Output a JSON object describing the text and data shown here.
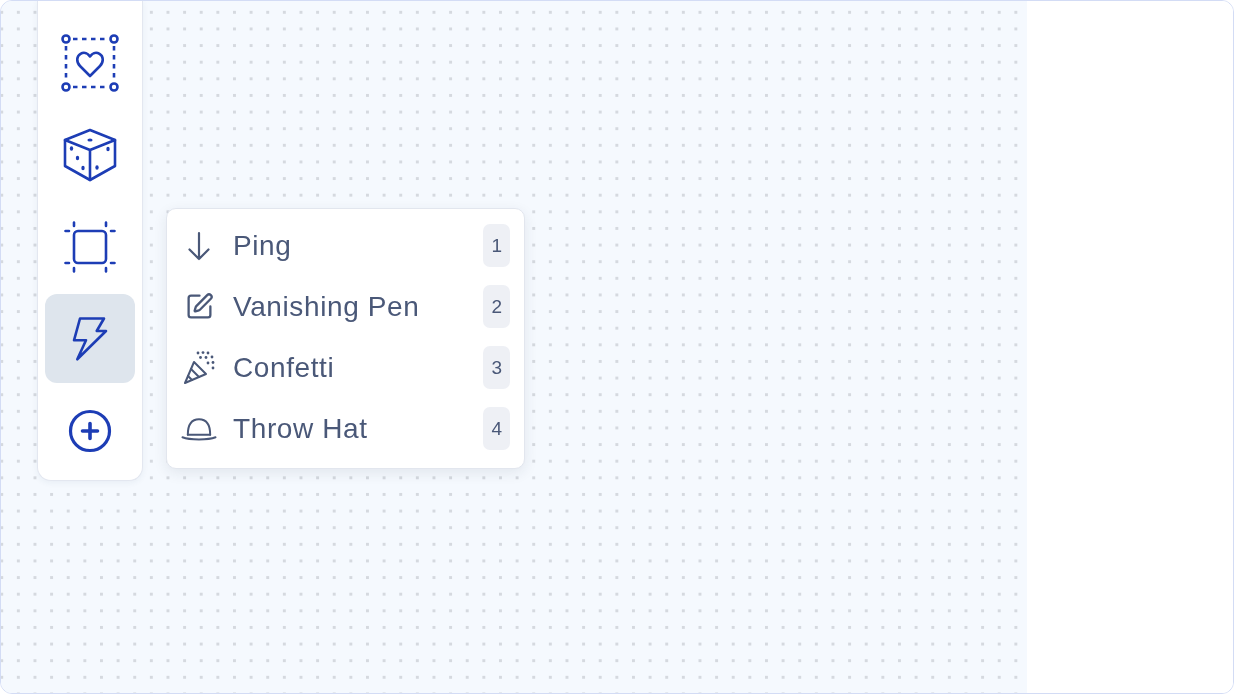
{
  "toolbar": {
    "tools": [
      {
        "selected": false
      },
      {
        "selected": false
      },
      {
        "selected": false
      },
      {
        "selected": true
      },
      {
        "selected": false
      }
    ]
  },
  "menu": {
    "items": [
      {
        "label": "Ping",
        "shortcut": "1"
      },
      {
        "label": "Vanishing Pen",
        "shortcut": "2"
      },
      {
        "label": "Confetti",
        "shortcut": "3"
      },
      {
        "label": "Throw Hat",
        "shortcut": "4"
      }
    ]
  }
}
